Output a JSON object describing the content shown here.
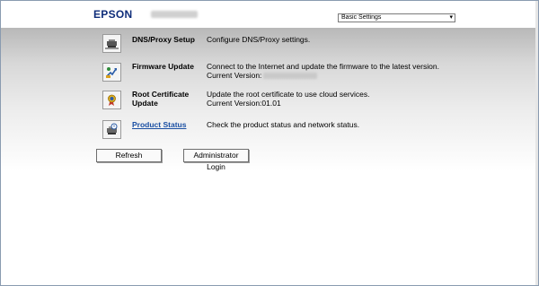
{
  "header": {
    "brand": "EPSON",
    "menu_selected": "Basic Settings"
  },
  "rows": [
    {
      "label": "DNS/Proxy Setup",
      "desc": "Configure DNS/Proxy settings.",
      "icon": "network-settings-icon"
    },
    {
      "label": "Firmware Update",
      "desc": "Connect to the Internet and update the firmware to the latest version.",
      "desc2_prefix": "Current Version:",
      "icon": "firmware-update-icon"
    },
    {
      "label_line1": "Root Certificate",
      "label_line2": "Update",
      "desc": "Update the root certificate to use cloud services.",
      "desc2": "Current Version:01.01",
      "icon": "certificate-icon"
    },
    {
      "label": "Product Status",
      "desc": "Check the product status and network status.",
      "icon": "product-status-icon"
    }
  ],
  "buttons": {
    "refresh": "Refresh",
    "admin_login": "Administrator Login"
  }
}
